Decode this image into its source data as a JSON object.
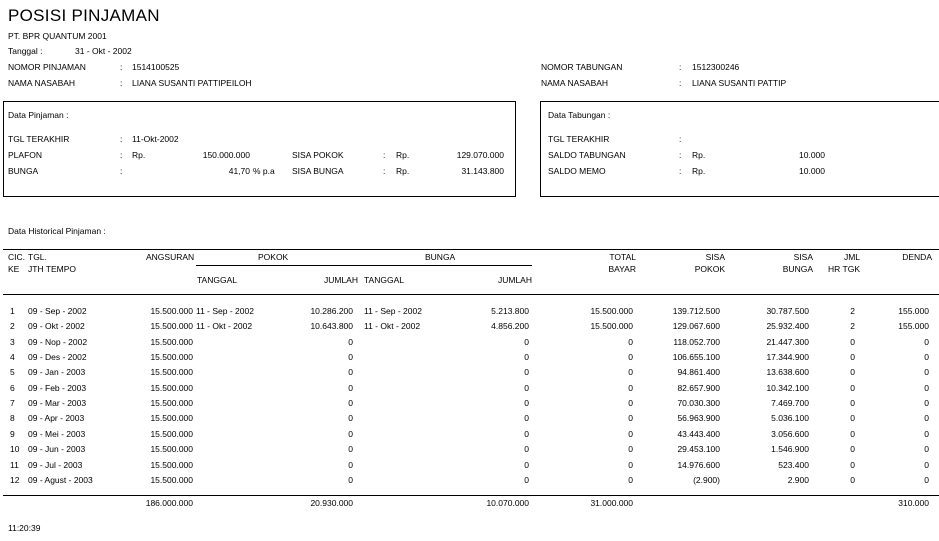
{
  "report": {
    "title": "POSISI  PINJAMAN",
    "company": "PT. BPR QUANTUM 2001",
    "date_label": "Tanggal :",
    "date_value": "31 - Okt - 2002",
    "loan_no_label": "NOMOR PINJAMAN",
    "loan_no_value": "1514100525",
    "loan_name_label": "NAMA NASABAH",
    "loan_name_value": "LIANA SUSANTI PATTIPEILOH",
    "sav_no_label": "NOMOR TABUNGAN",
    "sav_no_value": "1512300246",
    "sav_name_label": "NAMA NASABAH",
    "sav_name_value": "LIANA SUSANTI PATTIP",
    "colon": ":",
    "footer_time": "11:20:39"
  },
  "loan_box": {
    "heading": "Data Pinjaman :",
    "last_date_label": "TGL TERAKHIR",
    "last_date_value": "11-Okt-2002",
    "plafon_label": "PLAFON",
    "currency": "Rp.",
    "plafon_value": "150.000.000",
    "bunga_label": "BUNGA",
    "bunga_value": "41,70",
    "bunga_unit": "% p.a",
    "sisa_pokok_label": "SISA POKOK",
    "sisa_pokok_value": "129.070.000",
    "sisa_bunga_label": "SISA BUNGA",
    "sisa_bunga_value": "31.143.800"
  },
  "savings_box": {
    "heading": "Data Tabungan :",
    "last_date_label": "TGL TERAKHIR",
    "saldo_label": "SALDO TABUNGAN",
    "saldo_value": "10.000",
    "memo_label": "SALDO MEMO",
    "memo_value": "10.000",
    "currency": "Rp."
  },
  "history": {
    "heading": "Data Historical Pinjaman :",
    "headers": {
      "cic": "CIC.",
      "ke": "KE",
      "tgl": "TGL.",
      "jth_tempo": "JTH TEMPO",
      "angsuran": "ANGSURAN",
      "pokok": "POKOK",
      "bunga": "BUNGA",
      "tanggal": "TANGGAL",
      "jumlah": "JUMLAH",
      "total": "TOTAL",
      "bayar": "BAYAR",
      "sisa": "SISA",
      "sisa_pokok": "POKOK",
      "sisa_bunga": "BUNGA",
      "jml": "JML",
      "hr_tgk": "HR TGK",
      "denda": "DENDA"
    },
    "rows": [
      {
        "ke": "1",
        "due": "09 - Sep - 2002",
        "angsuran": "15.500.000",
        "pokok_tgl": "11 - Sep - 2002",
        "pokok_jml": "10.286.200",
        "bunga_tgl": "11 - Sep - 2002",
        "bunga_jml": "5.213.800",
        "total": "15.500.000",
        "sisa_pokok": "139.712.500",
        "sisa_bunga": "30.787.500",
        "jml": "2",
        "denda": "155.000"
      },
      {
        "ke": "2",
        "due": "09 - Okt - 2002",
        "angsuran": "15.500.000",
        "pokok_tgl": "11 - Okt - 2002",
        "pokok_jml": "10.643.800",
        "bunga_tgl": "11 - Okt - 2002",
        "bunga_jml": "4.856.200",
        "total": "15.500.000",
        "sisa_pokok": "129.067.600",
        "sisa_bunga": "25.932.400",
        "jml": "2",
        "denda": "155.000"
      },
      {
        "ke": "3",
        "due": "09 - Nop - 2002",
        "angsuran": "15.500.000",
        "pokok_tgl": "",
        "pokok_jml": "0",
        "bunga_tgl": "",
        "bunga_jml": "0",
        "total": "0",
        "sisa_pokok": "118.052.700",
        "sisa_bunga": "21.447.300",
        "jml": "0",
        "denda": "0"
      },
      {
        "ke": "4",
        "due": "09 - Des - 2002",
        "angsuran": "15.500.000",
        "pokok_tgl": "",
        "pokok_jml": "0",
        "bunga_tgl": "",
        "bunga_jml": "0",
        "total": "0",
        "sisa_pokok": "106.655.100",
        "sisa_bunga": "17.344.900",
        "jml": "0",
        "denda": "0"
      },
      {
        "ke": "5",
        "due": "09 - Jan - 2003",
        "angsuran": "15.500.000",
        "pokok_tgl": "",
        "pokok_jml": "0",
        "bunga_tgl": "",
        "bunga_jml": "0",
        "total": "0",
        "sisa_pokok": "94.861.400",
        "sisa_bunga": "13.638.600",
        "jml": "0",
        "denda": "0"
      },
      {
        "ke": "6",
        "due": "09 - Feb - 2003",
        "angsuran": "15.500.000",
        "pokok_tgl": "",
        "pokok_jml": "0",
        "bunga_tgl": "",
        "bunga_jml": "0",
        "total": "0",
        "sisa_pokok": "82.657.900",
        "sisa_bunga": "10.342.100",
        "jml": "0",
        "denda": "0"
      },
      {
        "ke": "7",
        "due": "09 - Mar - 2003",
        "angsuran": "15.500.000",
        "pokok_tgl": "",
        "pokok_jml": "0",
        "bunga_tgl": "",
        "bunga_jml": "0",
        "total": "0",
        "sisa_pokok": "70.030.300",
        "sisa_bunga": "7.469.700",
        "jml": "0",
        "denda": "0"
      },
      {
        "ke": "8",
        "due": "09 - Apr - 2003",
        "angsuran": "15.500.000",
        "pokok_tgl": "",
        "pokok_jml": "0",
        "bunga_tgl": "",
        "bunga_jml": "0",
        "total": "0",
        "sisa_pokok": "56.963.900",
        "sisa_bunga": "5.036.100",
        "jml": "0",
        "denda": "0"
      },
      {
        "ke": "9",
        "due": "09 - Mei - 2003",
        "angsuran": "15.500.000",
        "pokok_tgl": "",
        "pokok_jml": "0",
        "bunga_tgl": "",
        "bunga_jml": "0",
        "total": "0",
        "sisa_pokok": "43.443.400",
        "sisa_bunga": "3.056.600",
        "jml": "0",
        "denda": "0"
      },
      {
        "ke": "10",
        "due": "09 - Jun - 2003",
        "angsuran": "15.500.000",
        "pokok_tgl": "",
        "pokok_jml": "0",
        "bunga_tgl": "",
        "bunga_jml": "0",
        "total": "0",
        "sisa_pokok": "29.453.100",
        "sisa_bunga": "1.546.900",
        "jml": "0",
        "denda": "0"
      },
      {
        "ke": "11",
        "due": "09 - Jul - 2003",
        "angsuran": "15.500.000",
        "pokok_tgl": "",
        "pokok_jml": "0",
        "bunga_tgl": "",
        "bunga_jml": "0",
        "total": "0",
        "sisa_pokok": "14.976.600",
        "sisa_bunga": "523.400",
        "jml": "0",
        "denda": "0"
      },
      {
        "ke": "12",
        "due": "09 - Agust - 2003",
        "angsuran": "15.500.000",
        "pokok_tgl": "",
        "pokok_jml": "0",
        "bunga_tgl": "",
        "bunga_jml": "0",
        "total": "0",
        "sisa_pokok": "(2.900)",
        "sisa_bunga": "2.900",
        "jml": "0",
        "denda": "0"
      }
    ],
    "totals": {
      "angsuran": "186.000.000",
      "pokok_jml": "20.930.000",
      "bunga_jml": "10.070.000",
      "total": "31.000.000",
      "denda": "310.000"
    }
  }
}
